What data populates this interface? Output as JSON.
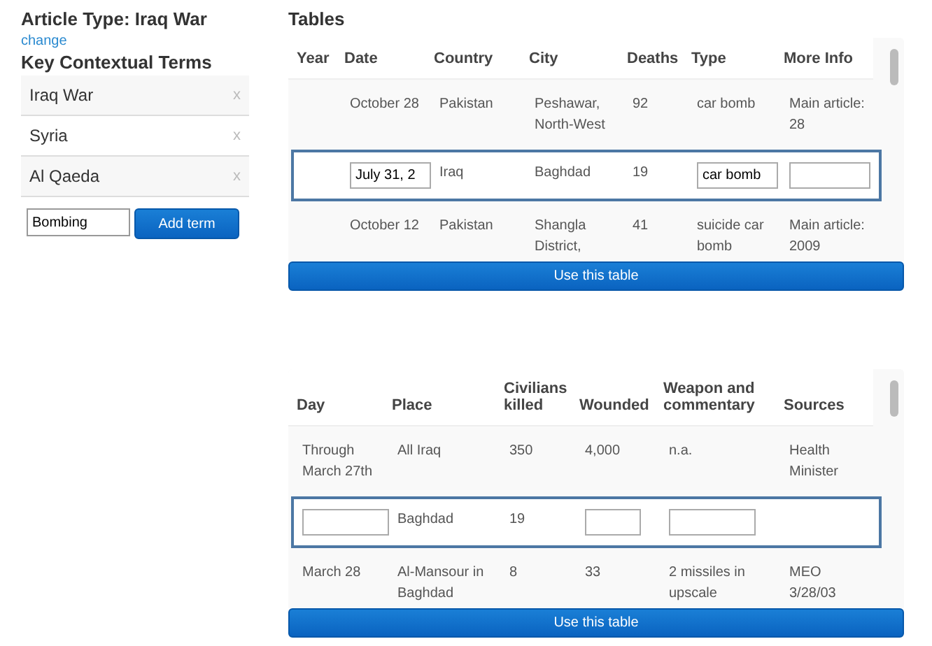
{
  "sidebar": {
    "article_type": "Article Type: Iraq War",
    "change_link": "change",
    "terms_heading": "Key Contextual Terms",
    "terms": [
      {
        "label": "Iraq War",
        "remove": "x"
      },
      {
        "label": "Syria",
        "remove": "x"
      },
      {
        "label": "Al Qaeda",
        "remove": "x"
      }
    ],
    "new_term": {
      "value": "Bombing"
    },
    "add_button": "Add term"
  },
  "tables_heading": "Tables",
  "tables": [
    {
      "columns": [
        "Year",
        "Date",
        "Country",
        "City",
        "Deaths",
        "Type",
        "More Info"
      ],
      "rows": [
        {
          "selected": false,
          "cells": [
            {
              "kind": "text"
            },
            {
              "kind": "text",
              "text": "October 28"
            },
            {
              "kind": "text",
              "text": "Pakistan"
            },
            {
              "kind": "text",
              "text": "Peshawar, North-West"
            },
            {
              "kind": "text",
              "text": "92"
            },
            {
              "kind": "text",
              "text": "car bomb"
            },
            {
              "kind": "text",
              "text": "Main article: 28"
            }
          ]
        },
        {
          "selected": true,
          "cells": [
            {
              "kind": "text"
            },
            {
              "kind": "input",
              "value": "July 31, 2"
            },
            {
              "kind": "text",
              "text": "Iraq"
            },
            {
              "kind": "text",
              "text": "Baghdad"
            },
            {
              "kind": "text",
              "text": "19"
            },
            {
              "kind": "input",
              "value": "car bomb"
            },
            {
              "kind": "input"
            }
          ]
        },
        {
          "selected": false,
          "cells": [
            {
              "kind": "text"
            },
            {
              "kind": "text",
              "text": "October 12"
            },
            {
              "kind": "text",
              "text": "Pakistan"
            },
            {
              "kind": "text",
              "text": "Shangla District,"
            },
            {
              "kind": "text",
              "text": "41"
            },
            {
              "kind": "text",
              "text": "suicide car bomb"
            },
            {
              "kind": "text",
              "text": "Main article: 2009"
            }
          ]
        }
      ],
      "button": "Use this table"
    },
    {
      "columns": [
        "Day",
        "Place",
        "Civilians killed",
        "Wounded",
        "Weapon and commentary",
        "Sources"
      ],
      "rows": [
        {
          "selected": false,
          "cells": [
            {
              "kind": "text",
              "text": "Through March 27th"
            },
            {
              "kind": "text",
              "text": "All Iraq"
            },
            {
              "kind": "text",
              "text": "350"
            },
            {
              "kind": "text",
              "text": "4,000"
            },
            {
              "kind": "text",
              "text": "n.a."
            },
            {
              "kind": "text",
              "text": "Health Minister"
            }
          ]
        },
        {
          "selected": true,
          "cells": [
            {
              "kind": "input"
            },
            {
              "kind": "text",
              "text": "Baghdad"
            },
            {
              "kind": "text",
              "text": "19"
            },
            {
              "kind": "input"
            },
            {
              "kind": "input"
            },
            {
              "kind": "text"
            }
          ]
        },
        {
          "selected": false,
          "cells": [
            {
              "kind": "text",
              "text": "March 28"
            },
            {
              "kind": "text",
              "text": "Al-Mansour in Baghdad"
            },
            {
              "kind": "text",
              "text": "8"
            },
            {
              "kind": "text",
              "text": "33"
            },
            {
              "kind": "text",
              "text": "2 missiles in upscale"
            },
            {
              "kind": "text",
              "text": "MEO 3/28/03"
            }
          ]
        }
      ],
      "button": "Use this table"
    }
  ]
}
